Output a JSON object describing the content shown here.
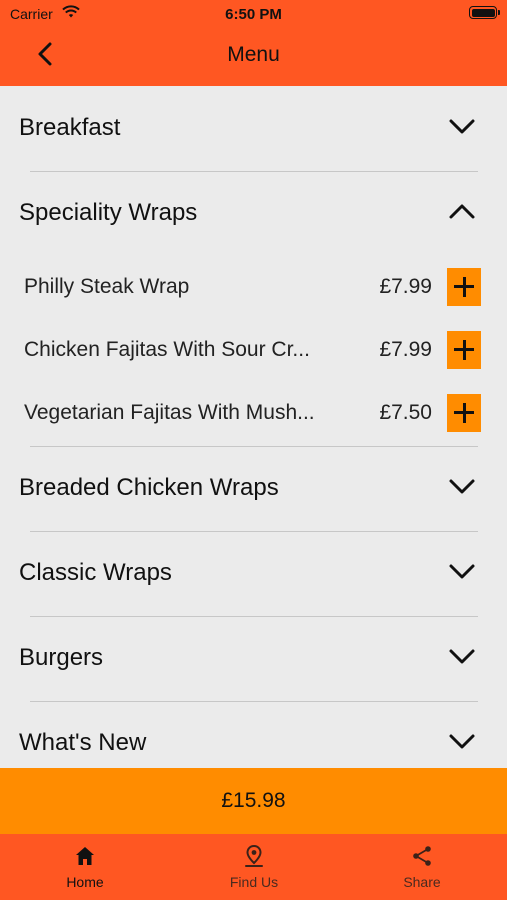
{
  "status_bar": {
    "carrier": "Carrier",
    "time": "6:50 PM"
  },
  "header": {
    "title": "Menu",
    "back_icon": "chevron-left-icon"
  },
  "categories": [
    {
      "label": "Breakfast",
      "expanded": false
    },
    {
      "label": "Speciality Wraps",
      "expanded": true,
      "items": [
        {
          "name": "Philly Steak Wrap",
          "price": "£7.99"
        },
        {
          "name": "Chicken Fajitas With Sour Cr...",
          "price": "£7.99"
        },
        {
          "name": "Vegetarian Fajitas With Mush...",
          "price": "£7.50"
        }
      ]
    },
    {
      "label": "Breaded Chicken Wraps",
      "expanded": false
    },
    {
      "label": "Classic Wraps",
      "expanded": false
    },
    {
      "label": "Burgers",
      "expanded": false
    },
    {
      "label": "What's New",
      "expanded": false
    }
  ],
  "basket": {
    "total": "£15.98"
  },
  "tabs": [
    {
      "label": "Home",
      "icon": "home-icon",
      "active": true
    },
    {
      "label": "Find Us",
      "icon": "location-pin-icon",
      "active": false
    },
    {
      "label": "Share",
      "icon": "share-icon",
      "active": false
    }
  ],
  "colors": {
    "header": "#ff5722",
    "accent": "#ff8c00",
    "background": "#ebebeb"
  }
}
